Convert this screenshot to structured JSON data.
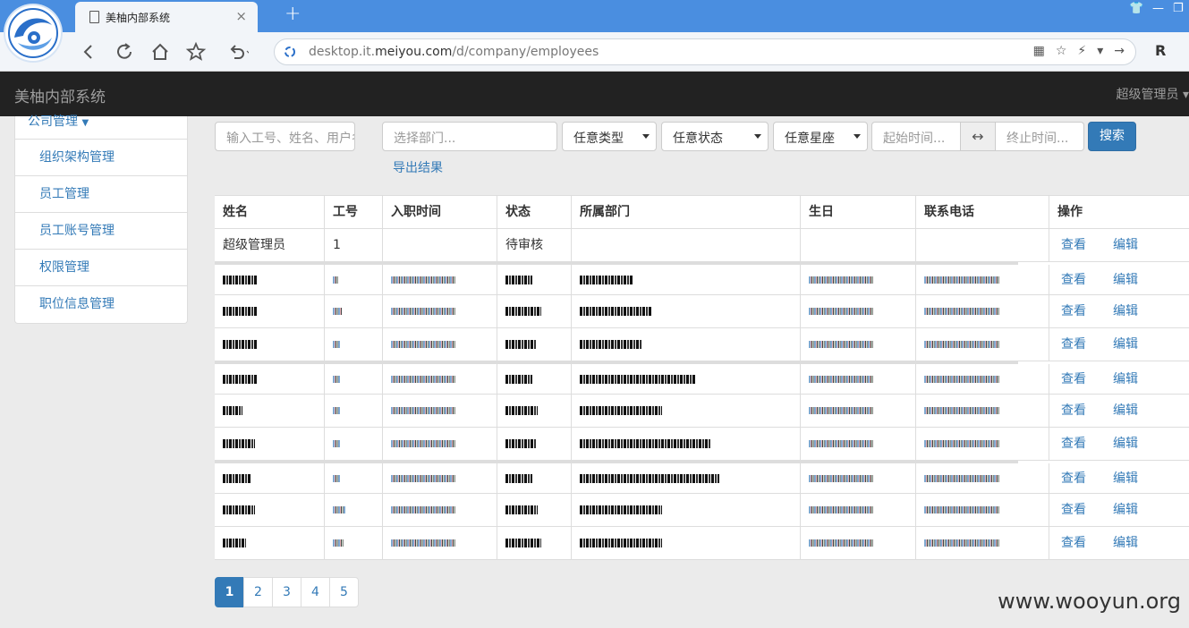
{
  "browser": {
    "tab_title": "美柚内部系统",
    "tab_close": "×",
    "newtab": "+",
    "url_prefix": "desktop.it.",
    "url_domain": "meiyou.com",
    "url_path": "/d/company/employees",
    "win_shirt": "👕",
    "win_min": "—",
    "win_max": "❐"
  },
  "navbar": {
    "brand": "美柚内部系统",
    "user": "超级管理员"
  },
  "sidebar": {
    "header": "公司管理",
    "items": [
      "组织架构管理",
      "员工管理",
      "员工账号管理",
      "权限管理",
      "职位信息管理"
    ]
  },
  "filters": {
    "keyword_placeholder": "输入工号、姓名、用户名",
    "dept_placeholder": "选择部门...",
    "type": "任意类型",
    "status": "任意状态",
    "zodiac": "任意星座",
    "start_placeholder": "起始时间...",
    "range_icon": "↔",
    "end_placeholder": "终止时间...",
    "search": "搜索",
    "export": "导出结果"
  },
  "table": {
    "headers": [
      "姓名",
      "工号",
      "入职时间",
      "状态",
      "所属部门",
      "生日",
      "联系电话",
      "操作"
    ],
    "first_row": {
      "name": "超级管理员",
      "id": "1",
      "status": "待审核"
    },
    "view": "查看",
    "edit": "编辑"
  },
  "pagination": {
    "pages": [
      "1",
      "2",
      "3",
      "4",
      "5"
    ],
    "active": "1"
  },
  "watermark": "www.wooyun.org"
}
